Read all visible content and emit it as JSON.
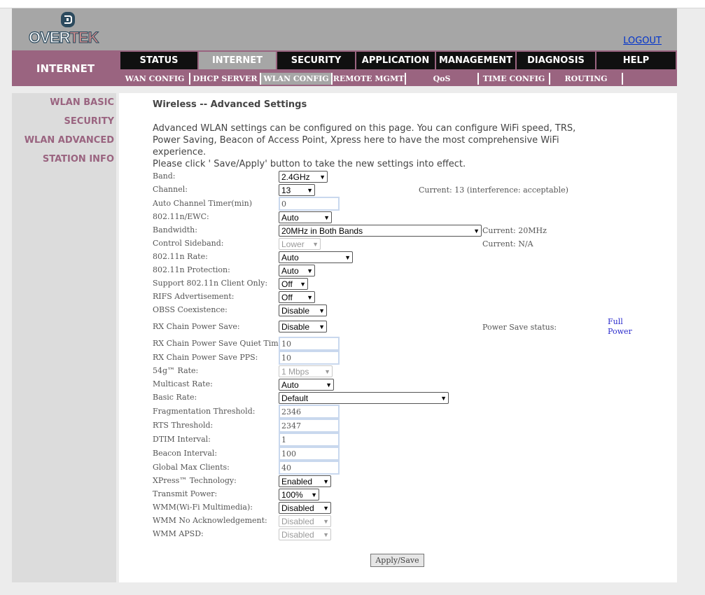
{
  "brand": {
    "logo_part1": "OVER",
    "logo_part2": "TEK"
  },
  "header": {
    "logout": "LOGOUT",
    "section": "INTERNET"
  },
  "main_tabs": [
    "STATUS",
    "INTERNET",
    "SECURITY",
    "APPLICATION",
    "MANAGEMENT",
    "DIAGNOSIS",
    "HELP"
  ],
  "active_main_tab": "INTERNET",
  "sub_tabs": [
    "WAN CONFIG",
    "DHCP SERVER",
    "WLAN CONFIG",
    "REMOTE MGMT",
    "QoS",
    "TIME CONFIG",
    "ROUTING"
  ],
  "active_sub_tab": "WLAN CONFIG",
  "sidebar": [
    "WLAN BASIC",
    "SECURITY",
    "WLAN ADVANCED",
    "STATION INFO"
  ],
  "page": {
    "title": "Wireless -- Advanced Settings",
    "intro_1": "Advanced WLAN settings can be configured on this page. You can configure WiFi speed, TRS,",
    "intro_2": "Power Saving, Beacon of Access Point, Xpress here to have the most comprehensive WiFi experience.",
    "intro_3": "Please click ' Save/Apply' button to take the new settings into effect."
  },
  "fields": {
    "band": {
      "label": "Band:",
      "value": "2.4GHz"
    },
    "channel": {
      "label": "Channel:",
      "value": "13",
      "note": "Current: 13 (interference: acceptable)"
    },
    "auto_channel_timer": {
      "label": "Auto Channel Timer(min)",
      "value": "0"
    },
    "ewc": {
      "label": "802.11n/EWC:",
      "value": "Auto"
    },
    "bandwidth": {
      "label": "Bandwidth:",
      "value": "20MHz in Both Bands",
      "note": "Current: 20MHz"
    },
    "control_sideband": {
      "label": "Control Sideband:",
      "value": "Lower",
      "note": "Current: N/A"
    },
    "n_rate": {
      "label": "802.11n Rate:",
      "value": "Auto"
    },
    "n_protection": {
      "label": "802.11n Protection:",
      "value": "Auto"
    },
    "n_client_only": {
      "label": "Support 802.11n Client Only:",
      "value": "Off"
    },
    "rifs": {
      "label": "RIFS Advertisement:",
      "value": "Off"
    },
    "obss": {
      "label": "OBSS Coexistence:",
      "value": "Disable"
    },
    "rx_chain_ps": {
      "label": "RX Chain Power Save:",
      "value": "Disable",
      "note": "Power Save status:",
      "status_1": "Full",
      "status_2": "Power"
    },
    "rx_quiet_time": {
      "label": "RX Chain Power Save Quiet Time:",
      "value": "10"
    },
    "rx_pps": {
      "label": "RX Chain Power Save PPS:",
      "value": "10"
    },
    "rate_54g": {
      "label": "54g™ Rate:",
      "value": "1 Mbps"
    },
    "multicast_rate": {
      "label": "Multicast Rate:",
      "value": "Auto"
    },
    "basic_rate": {
      "label": "Basic Rate:",
      "value": "Default"
    },
    "frag_threshold": {
      "label": "Fragmentation Threshold:",
      "value": "2346"
    },
    "rts_threshold": {
      "label": "RTS Threshold:",
      "value": "2347"
    },
    "dtim": {
      "label": "DTIM Interval:",
      "value": "1"
    },
    "beacon": {
      "label": "Beacon Interval:",
      "value": "100"
    },
    "max_clients": {
      "label": "Global Max Clients:",
      "value": "40"
    },
    "xpress": {
      "label": "XPress™ Technology:",
      "value": "Enabled"
    },
    "tx_power": {
      "label": "Transmit Power:",
      "value": "100%"
    },
    "wmm": {
      "label": "WMM(Wi-Fi Multimedia):",
      "value": "Disabled"
    },
    "wmm_noack": {
      "label": "WMM No Acknowledgement:",
      "value": "Disabled"
    },
    "wmm_apsd": {
      "label": "WMM APSD:",
      "value": "Disabled"
    }
  },
  "apply_label": "Apply/Save"
}
